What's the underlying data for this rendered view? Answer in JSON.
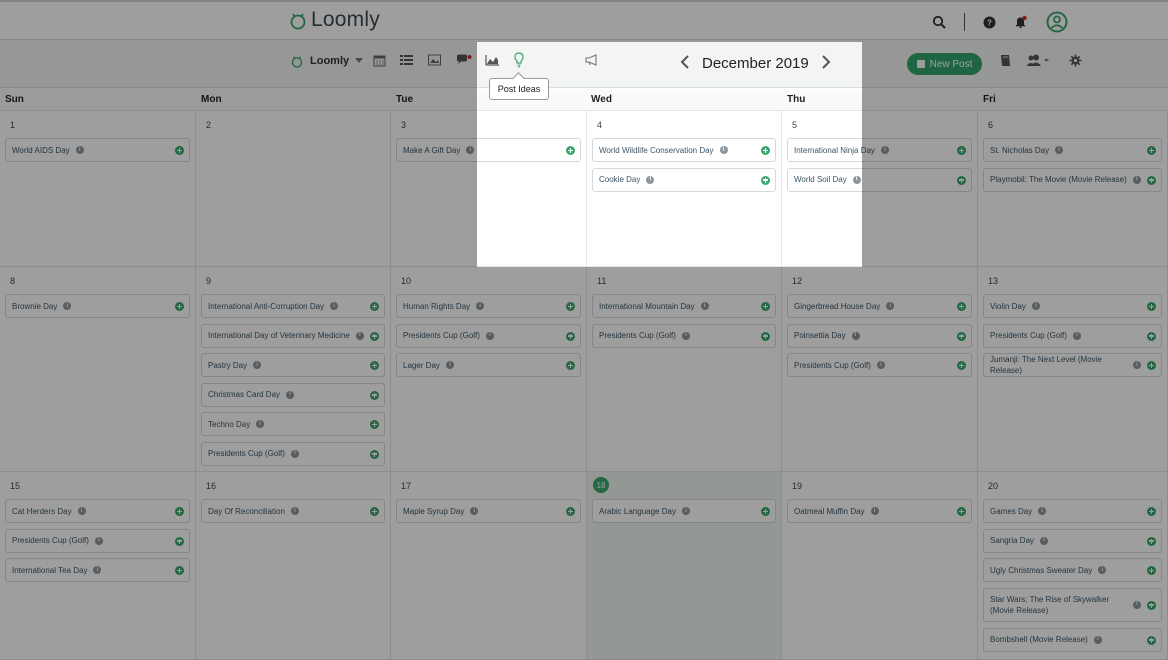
{
  "app": {
    "name": "Loomly"
  },
  "topbar": {
    "icons": [
      "search-icon",
      "help-icon",
      "notification-bell-icon",
      "user-account-icon"
    ]
  },
  "toolbar": {
    "brand": "Loomly",
    "view_icons": [
      "calendar-view-icon",
      "list-view-icon",
      "media-library-icon",
      "comments-icon",
      "analytics-icon",
      "post-ideas-icon",
      "advocacy-icon"
    ],
    "month": "December 2019",
    "new_post": "New Post",
    "right_icons": [
      "library-icon",
      "team-icon",
      "settings-icon"
    ],
    "tooltip": "Post Ideas"
  },
  "colors": {
    "accent": "#33a46b",
    "today": "#3aa66c",
    "text": "#3c5566"
  },
  "day_names": [
    "Sun",
    "Mon",
    "Tue",
    "Wed",
    "Thu",
    "Fri"
  ],
  "weeks": [
    [
      {
        "day": "1",
        "events": [
          "World AIDS Day"
        ]
      },
      {
        "day": "2",
        "events": []
      },
      {
        "day": "3",
        "events": [
          "Make A Gift Day"
        ]
      },
      {
        "day": "4",
        "events": [
          "World Wildlife Conservation Day",
          "Cookie Day"
        ]
      },
      {
        "day": "5",
        "events": [
          "International Ninja Day",
          "World Soil Day"
        ]
      },
      {
        "day": "6",
        "events": [
          "St. Nicholas Day",
          "Playmobil: The Movie (Movie Release)"
        ]
      }
    ],
    [
      {
        "day": "8",
        "events": [
          "Brownie Day"
        ]
      },
      {
        "day": "9",
        "events": [
          "International Anti-Corruption Day",
          "International Day of Veterinary Medicine",
          "Pastry Day",
          "Christmas Card Day",
          "Techno Day",
          "Presidents Cup (Golf)"
        ]
      },
      {
        "day": "10",
        "events": [
          "Human Rights Day",
          "Presidents Cup (Golf)",
          "Lager Day"
        ]
      },
      {
        "day": "11",
        "events": [
          "International Mountain Day",
          "Presidents Cup (Golf)"
        ]
      },
      {
        "day": "12",
        "events": [
          "Gingerbread House Day",
          "Poinsettia Day",
          "Presidents Cup (Golf)"
        ]
      },
      {
        "day": "13",
        "events": [
          "Violin Day",
          "Presidents Cup (Golf)",
          "Jumanji: The Next Level (Movie Release)"
        ]
      }
    ],
    [
      {
        "day": "15",
        "events": [
          "Cat Herders Day",
          "Presidents Cup (Golf)",
          "International Tea Day"
        ]
      },
      {
        "day": "16",
        "events": [
          "Day Of Reconciliation"
        ]
      },
      {
        "day": "17",
        "events": [
          "Maple Syrup Day"
        ]
      },
      {
        "day": "18",
        "today": true,
        "events": [
          "Arabic Language Day"
        ]
      },
      {
        "day": "19",
        "events": [
          "Oatmeal Muffin Day"
        ]
      },
      {
        "day": "20",
        "events": [
          "Games Day",
          "Sangria Day",
          "Ugly Christmas Sweater Day",
          "Star Wars: The Rise of Skywalker (Movie Release)",
          "Bombshell (Movie Release)"
        ]
      }
    ]
  ]
}
